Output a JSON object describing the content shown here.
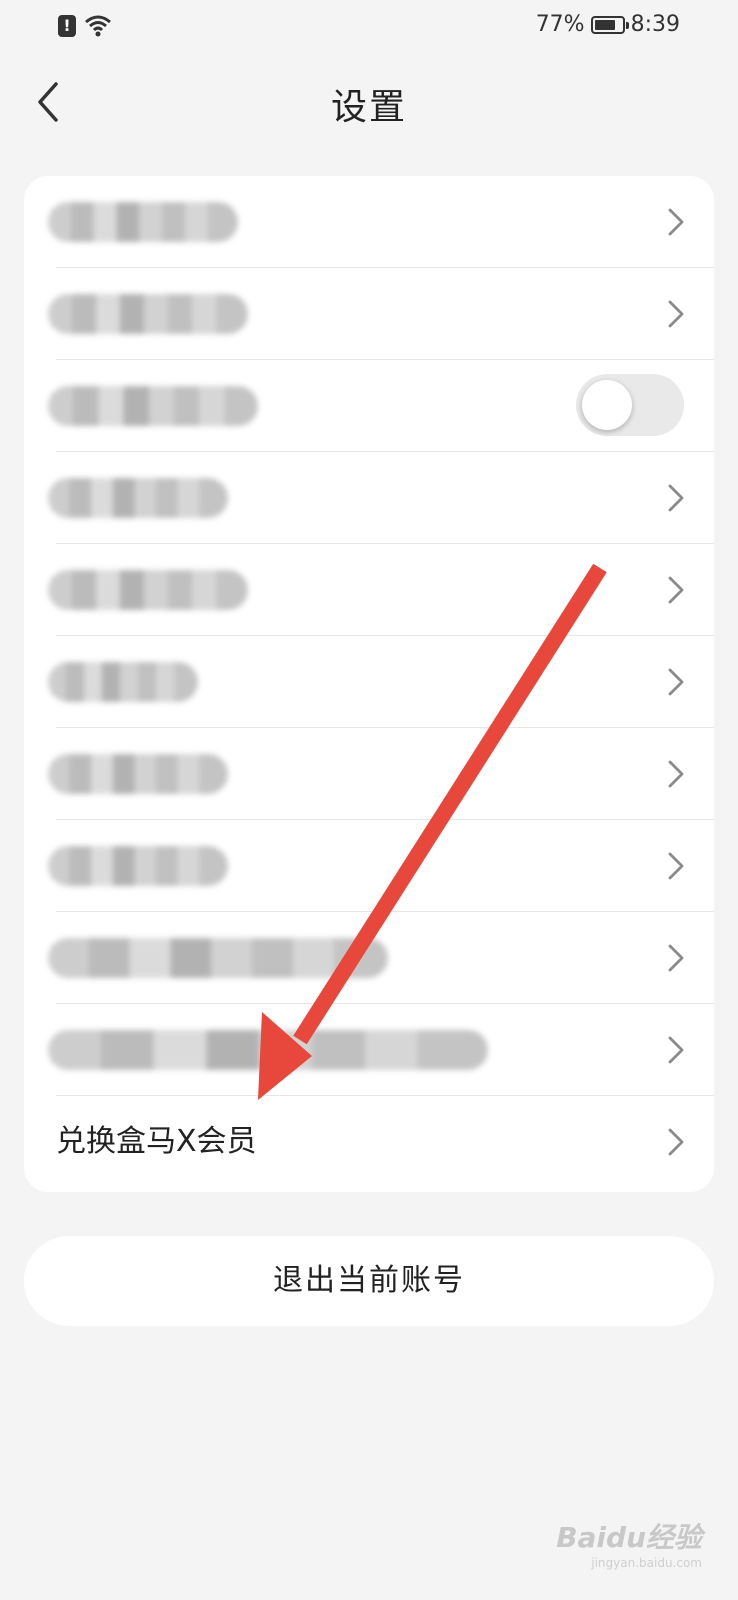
{
  "status_bar": {
    "battery_percent": "77%",
    "battery_level": 0.77,
    "time": "8:39"
  },
  "header": {
    "title": "设置"
  },
  "settings_rows": [
    {
      "label": "",
      "blurred": true,
      "control": "chevron"
    },
    {
      "label": "",
      "blurred": true,
      "control": "chevron"
    },
    {
      "label": "",
      "blurred": true,
      "control": "toggle",
      "toggle_on": false
    },
    {
      "label": "",
      "blurred": true,
      "control": "chevron"
    },
    {
      "label": "",
      "blurred": true,
      "control": "chevron"
    },
    {
      "label": "",
      "blurred": true,
      "control": "chevron"
    },
    {
      "label": "",
      "blurred": true,
      "control": "chevron"
    },
    {
      "label": "",
      "blurred": true,
      "control": "chevron"
    },
    {
      "label": "",
      "blurred": true,
      "control": "chevron"
    },
    {
      "label": "",
      "blurred": true,
      "control": "chevron"
    },
    {
      "label": "兑换盒马X会员",
      "blurred": false,
      "control": "chevron"
    }
  ],
  "logout": {
    "label": "退出当前账号"
  },
  "annotation": {
    "color": "#e8473b",
    "icon": "red-arrow"
  },
  "watermark": {
    "text": "Baidu经验",
    "sub": "jingyan.baidu.com"
  }
}
